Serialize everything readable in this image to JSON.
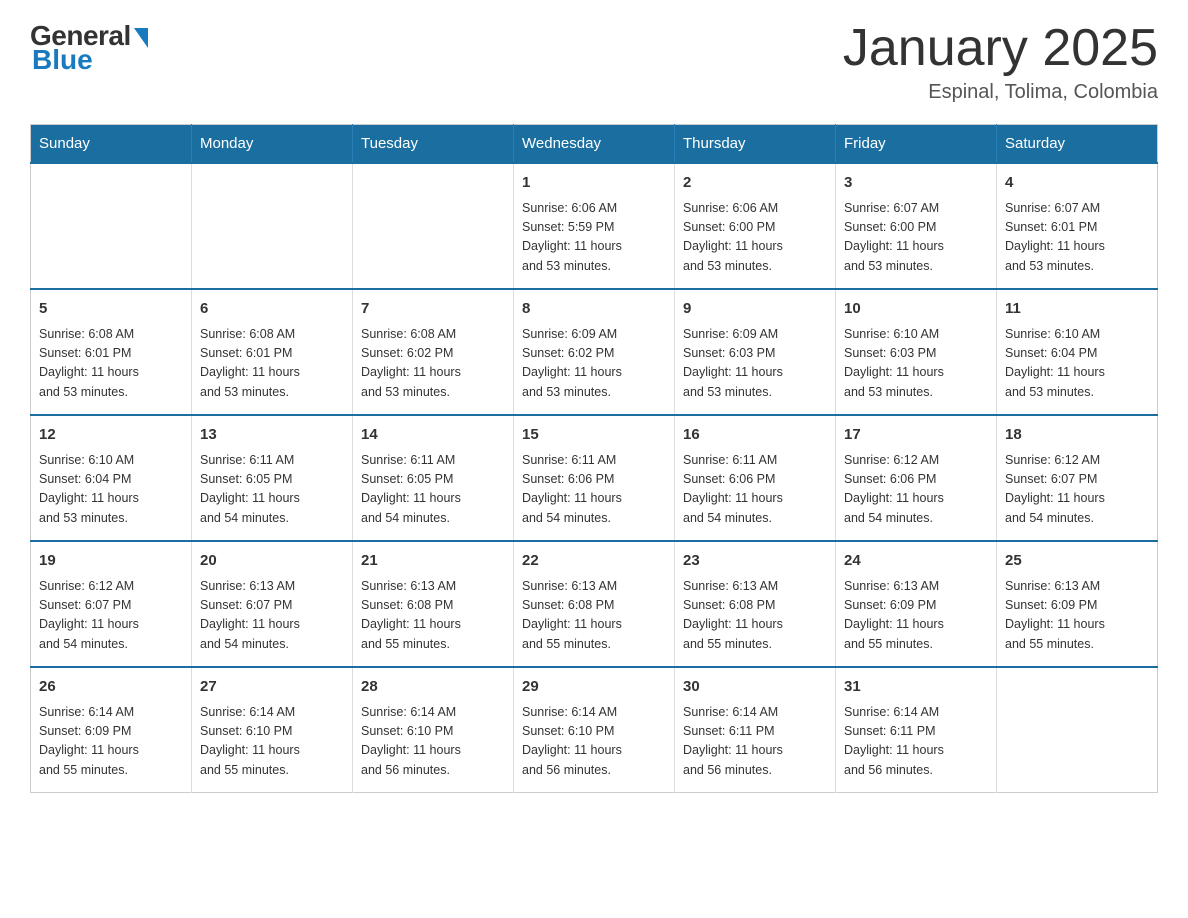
{
  "logo": {
    "general": "General",
    "blue": "Blue"
  },
  "header": {
    "title": "January 2025",
    "subtitle": "Espinal, Tolima, Colombia"
  },
  "calendar": {
    "days_of_week": [
      "Sunday",
      "Monday",
      "Tuesday",
      "Wednesday",
      "Thursday",
      "Friday",
      "Saturday"
    ],
    "weeks": [
      [
        {
          "day": "",
          "info": ""
        },
        {
          "day": "",
          "info": ""
        },
        {
          "day": "",
          "info": ""
        },
        {
          "day": "1",
          "info": "Sunrise: 6:06 AM\nSunset: 5:59 PM\nDaylight: 11 hours\nand 53 minutes."
        },
        {
          "day": "2",
          "info": "Sunrise: 6:06 AM\nSunset: 6:00 PM\nDaylight: 11 hours\nand 53 minutes."
        },
        {
          "day": "3",
          "info": "Sunrise: 6:07 AM\nSunset: 6:00 PM\nDaylight: 11 hours\nand 53 minutes."
        },
        {
          "day": "4",
          "info": "Sunrise: 6:07 AM\nSunset: 6:01 PM\nDaylight: 11 hours\nand 53 minutes."
        }
      ],
      [
        {
          "day": "5",
          "info": "Sunrise: 6:08 AM\nSunset: 6:01 PM\nDaylight: 11 hours\nand 53 minutes."
        },
        {
          "day": "6",
          "info": "Sunrise: 6:08 AM\nSunset: 6:01 PM\nDaylight: 11 hours\nand 53 minutes."
        },
        {
          "day": "7",
          "info": "Sunrise: 6:08 AM\nSunset: 6:02 PM\nDaylight: 11 hours\nand 53 minutes."
        },
        {
          "day": "8",
          "info": "Sunrise: 6:09 AM\nSunset: 6:02 PM\nDaylight: 11 hours\nand 53 minutes."
        },
        {
          "day": "9",
          "info": "Sunrise: 6:09 AM\nSunset: 6:03 PM\nDaylight: 11 hours\nand 53 minutes."
        },
        {
          "day": "10",
          "info": "Sunrise: 6:10 AM\nSunset: 6:03 PM\nDaylight: 11 hours\nand 53 minutes."
        },
        {
          "day": "11",
          "info": "Sunrise: 6:10 AM\nSunset: 6:04 PM\nDaylight: 11 hours\nand 53 minutes."
        }
      ],
      [
        {
          "day": "12",
          "info": "Sunrise: 6:10 AM\nSunset: 6:04 PM\nDaylight: 11 hours\nand 53 minutes."
        },
        {
          "day": "13",
          "info": "Sunrise: 6:11 AM\nSunset: 6:05 PM\nDaylight: 11 hours\nand 54 minutes."
        },
        {
          "day": "14",
          "info": "Sunrise: 6:11 AM\nSunset: 6:05 PM\nDaylight: 11 hours\nand 54 minutes."
        },
        {
          "day": "15",
          "info": "Sunrise: 6:11 AM\nSunset: 6:06 PM\nDaylight: 11 hours\nand 54 minutes."
        },
        {
          "day": "16",
          "info": "Sunrise: 6:11 AM\nSunset: 6:06 PM\nDaylight: 11 hours\nand 54 minutes."
        },
        {
          "day": "17",
          "info": "Sunrise: 6:12 AM\nSunset: 6:06 PM\nDaylight: 11 hours\nand 54 minutes."
        },
        {
          "day": "18",
          "info": "Sunrise: 6:12 AM\nSunset: 6:07 PM\nDaylight: 11 hours\nand 54 minutes."
        }
      ],
      [
        {
          "day": "19",
          "info": "Sunrise: 6:12 AM\nSunset: 6:07 PM\nDaylight: 11 hours\nand 54 minutes."
        },
        {
          "day": "20",
          "info": "Sunrise: 6:13 AM\nSunset: 6:07 PM\nDaylight: 11 hours\nand 54 minutes."
        },
        {
          "day": "21",
          "info": "Sunrise: 6:13 AM\nSunset: 6:08 PM\nDaylight: 11 hours\nand 55 minutes."
        },
        {
          "day": "22",
          "info": "Sunrise: 6:13 AM\nSunset: 6:08 PM\nDaylight: 11 hours\nand 55 minutes."
        },
        {
          "day": "23",
          "info": "Sunrise: 6:13 AM\nSunset: 6:08 PM\nDaylight: 11 hours\nand 55 minutes."
        },
        {
          "day": "24",
          "info": "Sunrise: 6:13 AM\nSunset: 6:09 PM\nDaylight: 11 hours\nand 55 minutes."
        },
        {
          "day": "25",
          "info": "Sunrise: 6:13 AM\nSunset: 6:09 PM\nDaylight: 11 hours\nand 55 minutes."
        }
      ],
      [
        {
          "day": "26",
          "info": "Sunrise: 6:14 AM\nSunset: 6:09 PM\nDaylight: 11 hours\nand 55 minutes."
        },
        {
          "day": "27",
          "info": "Sunrise: 6:14 AM\nSunset: 6:10 PM\nDaylight: 11 hours\nand 55 minutes."
        },
        {
          "day": "28",
          "info": "Sunrise: 6:14 AM\nSunset: 6:10 PM\nDaylight: 11 hours\nand 56 minutes."
        },
        {
          "day": "29",
          "info": "Sunrise: 6:14 AM\nSunset: 6:10 PM\nDaylight: 11 hours\nand 56 minutes."
        },
        {
          "day": "30",
          "info": "Sunrise: 6:14 AM\nSunset: 6:11 PM\nDaylight: 11 hours\nand 56 minutes."
        },
        {
          "day": "31",
          "info": "Sunrise: 6:14 AM\nSunset: 6:11 PM\nDaylight: 11 hours\nand 56 minutes."
        },
        {
          "day": "",
          "info": ""
        }
      ]
    ]
  }
}
